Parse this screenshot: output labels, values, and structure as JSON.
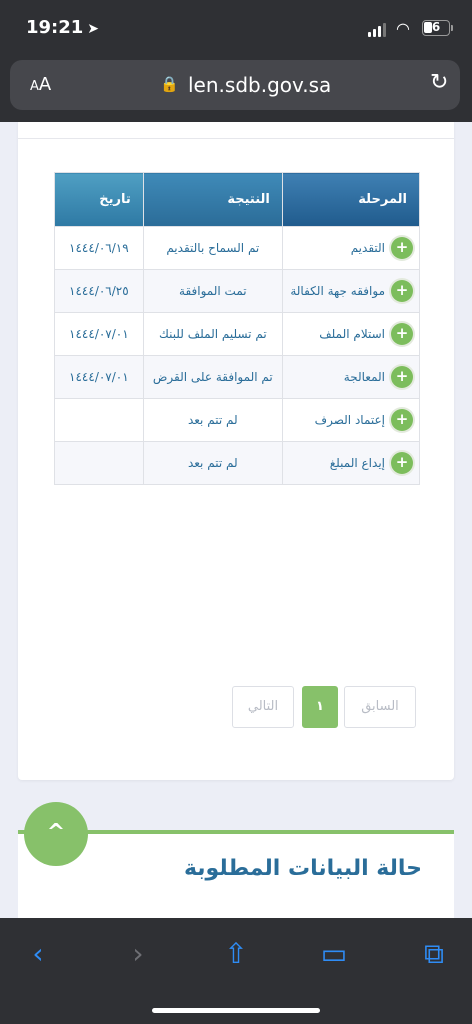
{
  "status": {
    "time": "19:21",
    "battery": "6"
  },
  "browser": {
    "aa_label": "AA",
    "url": "len.sdb.gov.sa"
  },
  "table": {
    "headers": {
      "stage": "المرحلة",
      "result": "النتيجة",
      "date": "تاريخ"
    },
    "rows": [
      {
        "stage": "التقديم",
        "result": "تم السماح بالتقديم",
        "date": "١٤٤٤/٠٦/١٩"
      },
      {
        "stage": "موافقه جهة الكفالة",
        "result": "تمت الموافقة",
        "date": "١٤٤٤/٠٦/٢٥"
      },
      {
        "stage": "استلام الملف",
        "result": "تم تسليم الملف للبنك",
        "date": "١٤٤٤/٠٧/٠١"
      },
      {
        "stage": "المعالجة",
        "result": "تم الموافقة على القرض",
        "date": "١٤٤٤/٠٧/٠١"
      },
      {
        "stage": "إعتماد الصرف",
        "result": "لم تتم بعد",
        "date": ""
      },
      {
        "stage": "إيداع المبلغ",
        "result": "لم تتم بعد",
        "date": ""
      }
    ]
  },
  "pagination": {
    "prev": "السابق",
    "current": "١",
    "next": "التالي"
  },
  "required_section": {
    "title": "حالة البيانات المطلوبة"
  },
  "colors": {
    "accent_green": "#87c16a",
    "header_blue": "#205b8d",
    "text_blue": "#2a6d99"
  },
  "icons": {
    "plus": "+",
    "scroll_up": "^",
    "back": "‹",
    "forward": "›",
    "share": "⇧",
    "bookmarks": "📖",
    "tabs": "⧉"
  }
}
